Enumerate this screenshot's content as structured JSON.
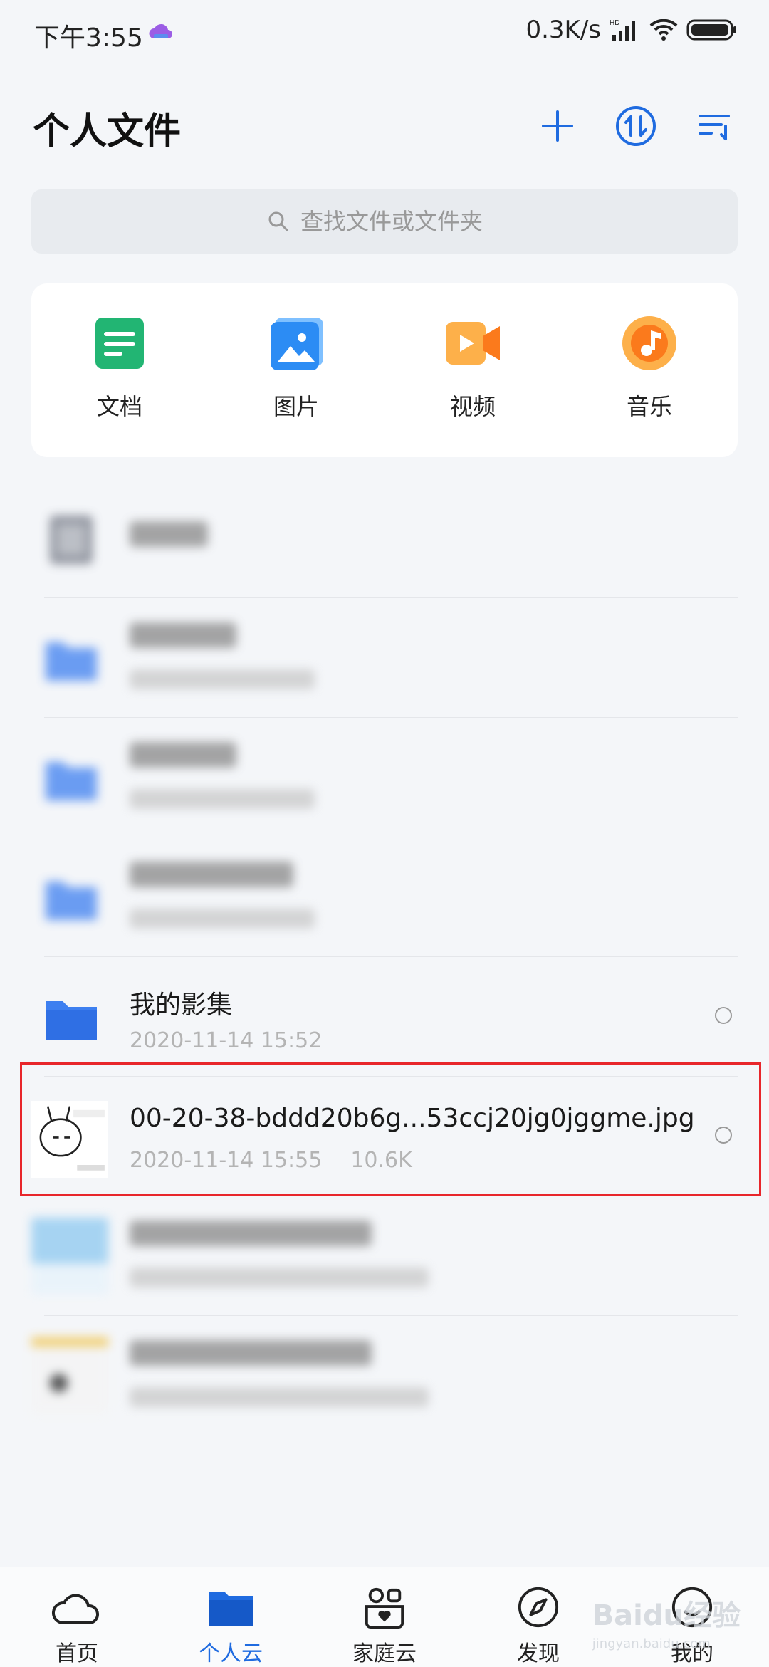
{
  "status_bar": {
    "time": "下午3:55",
    "speed": "0.3K/s",
    "hd": "HD"
  },
  "header": {
    "title": "个人文件",
    "add_icon": "plus-icon",
    "transfer_icon": "transfer-icon",
    "sort_icon": "sort-icon"
  },
  "search": {
    "placeholder": "查找文件或文件夹"
  },
  "categories": [
    {
      "label": "文档",
      "icon": "document-icon",
      "color": "#22b573"
    },
    {
      "label": "图片",
      "icon": "image-icon",
      "color": "#2c8cf4"
    },
    {
      "label": "视频",
      "icon": "video-icon",
      "color": "#fb8a1c"
    },
    {
      "label": "音乐",
      "icon": "music-icon",
      "color": "#fb8a1c"
    }
  ],
  "files": [
    {
      "name": "我的影集",
      "date": "2020-11-14 15:52",
      "size": ""
    },
    {
      "name": "00-20-38-bddd20b6g...53ccj20jg0jggme.jpg",
      "date": "2020-11-14 15:55",
      "size": "10.6K"
    }
  ],
  "nav": [
    {
      "label": "首页",
      "icon": "cloud-icon"
    },
    {
      "label": "个人云",
      "icon": "folder-icon",
      "active": true
    },
    {
      "label": "家庭云",
      "icon": "family-icon"
    },
    {
      "label": "发现",
      "icon": "compass-icon"
    },
    {
      "label": "我的",
      "icon": "profile-icon"
    }
  ],
  "watermark": {
    "text": "Baidu经验",
    "sub": "jingyan.baidu.com"
  },
  "colors": {
    "accent": "#1f6be0",
    "folder": "#3d7ff0",
    "highlight": "#e8262b"
  }
}
